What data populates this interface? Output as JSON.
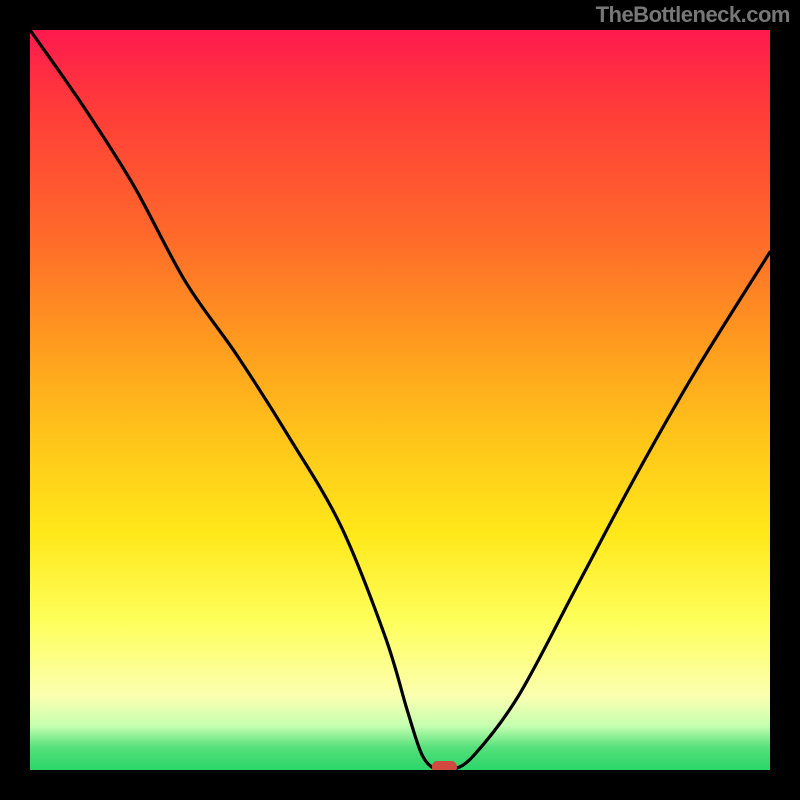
{
  "watermark": "TheBottleneck.com",
  "chart_data": {
    "type": "line",
    "title": "",
    "xlabel": "",
    "ylabel": "",
    "xlim": [
      0,
      100
    ],
    "ylim": [
      0,
      100
    ],
    "grid": false,
    "series": [
      {
        "name": "bottleneck-curve",
        "x": [
          0,
          7,
          14,
          21,
          28,
          35,
          42,
          48,
          51,
          53,
          55,
          57,
          60,
          66,
          74,
          82,
          90,
          100
        ],
        "values": [
          100,
          90,
          79,
          66,
          56,
          45,
          33,
          18,
          8,
          2,
          0,
          0,
          2,
          10,
          25,
          40,
          54,
          70
        ]
      }
    ],
    "annotations": [
      {
        "name": "optimal-marker",
        "x": 56,
        "y": 0,
        "shape": "pill",
        "color": "#d1493f"
      }
    ],
    "background_gradient_stops": [
      {
        "pos": 0,
        "color": "#ff1a4d"
      },
      {
        "pos": 10,
        "color": "#ff3a3a"
      },
      {
        "pos": 28,
        "color": "#ff6a2a"
      },
      {
        "pos": 42,
        "color": "#ff9a1f"
      },
      {
        "pos": 55,
        "color": "#ffc41a"
      },
      {
        "pos": 68,
        "color": "#ffe81a"
      },
      {
        "pos": 80,
        "color": "#feff5c"
      },
      {
        "pos": 90,
        "color": "#fbffb0"
      },
      {
        "pos": 94,
        "color": "#c6ffb0"
      },
      {
        "pos": 97,
        "color": "#54e07a"
      },
      {
        "pos": 100,
        "color": "#2bd66a"
      }
    ]
  }
}
